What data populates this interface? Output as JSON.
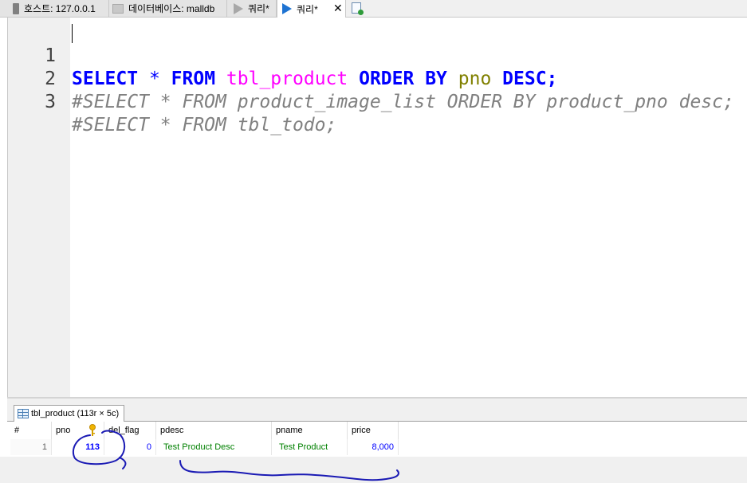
{
  "tabs": {
    "host_label": "호스트: 127.0.0.1",
    "database_label": "데이터베이스: malldb",
    "query1_label": "쿼리*",
    "query2_label": "쿼리*",
    "close_glyph": "✕"
  },
  "editor": {
    "lines": [
      {
        "number": "1",
        "tokens": [
          "SELECT",
          " ",
          "*",
          " ",
          "FROM",
          " ",
          "tbl_product",
          " ",
          "ORDER BY",
          " ",
          "pno",
          " ",
          "DESC",
          ";"
        ]
      },
      {
        "number": "2",
        "text": "#SELECT * FROM product_image_list ORDER BY product_pno desc;"
      },
      {
        "number": "3",
        "text": "#SELECT * FROM tbl_todo;"
      }
    ]
  },
  "result": {
    "tab_label": "tbl_product (113r × 5c)",
    "columns": [
      "#",
      "pno",
      "del_flag",
      "pdesc",
      "pname",
      "price"
    ],
    "rows": [
      {
        "row_num": "1",
        "pno": "113",
        "del_flag": "0",
        "pdesc": "Test Product Desc",
        "pname": "Test Product",
        "price": "8,000"
      }
    ]
  },
  "colors": {
    "keyword": "#0000ff",
    "table_name": "#ff00ff",
    "column_name": "#808000",
    "comment": "#808080",
    "number_cell": "#0000ff",
    "text_cell": "#008000",
    "annotation_ink": "#1a1ab4"
  },
  "icons": [
    "server-icon",
    "database-icon",
    "play-icon",
    "close-icon",
    "new-query-icon",
    "table-grid-icon",
    "primary-key-icon"
  ]
}
